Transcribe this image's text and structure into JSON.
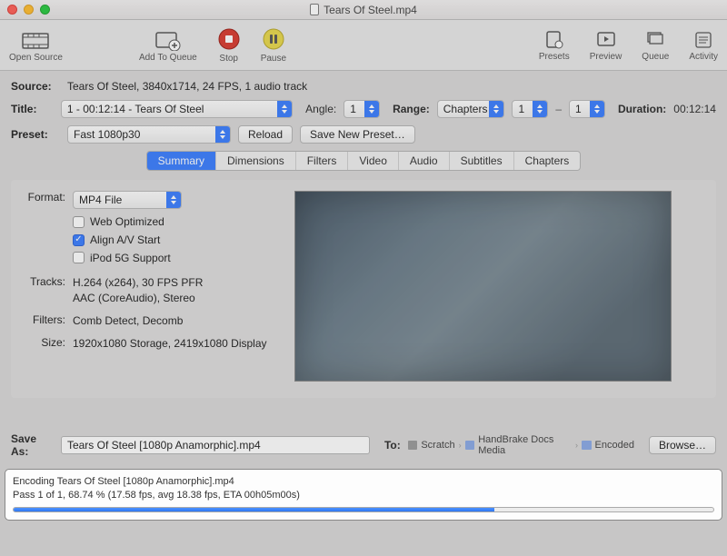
{
  "window": {
    "title": "Tears Of Steel.mp4"
  },
  "toolbar": {
    "open": "Open Source",
    "add": "Add To Queue",
    "stop": "Stop",
    "pause": "Pause",
    "presets": "Presets",
    "preview": "Preview",
    "queue": "Queue",
    "activity": "Activity"
  },
  "source": {
    "label": "Source:",
    "text": "Tears Of Steel, 3840x1714, 24 FPS, 1 audio track"
  },
  "title_row": {
    "label": "Title:",
    "value": "1 - 00:12:14 - Tears Of Steel",
    "angle_label": "Angle:",
    "angle": "1",
    "range_label": "Range:",
    "range_mode": "Chapters",
    "range_from": "1",
    "range_to": "1",
    "duration_label": "Duration:",
    "duration": "00:12:14"
  },
  "preset_row": {
    "label": "Preset:",
    "value": "Fast 1080p30",
    "reload": "Reload",
    "save_new": "Save New Preset…"
  },
  "tabs": [
    "Summary",
    "Dimensions",
    "Filters",
    "Video",
    "Audio",
    "Subtitles",
    "Chapters"
  ],
  "summary": {
    "format_label": "Format:",
    "format_value": "MP4 File",
    "web_opt": "Web Optimized",
    "align_av": "Align A/V Start",
    "ipod": "iPod 5G Support",
    "tracks_label": "Tracks:",
    "tracks_value": "H.264 (x264), 30 FPS PFR\nAAC (CoreAudio), Stereo",
    "filters_label": "Filters:",
    "filters_value": "Comb Detect, Decomb",
    "size_label": "Size:",
    "size_value": "1920x1080 Storage, 2419x1080 Display"
  },
  "save": {
    "label": "Save As:",
    "filename": "Tears Of Steel [1080p Anamorphic].mp4",
    "to_label": "To:",
    "path": [
      "Scratch",
      "HandBrake Docs Media",
      "Encoded"
    ],
    "browse": "Browse…"
  },
  "status": {
    "line1": "Encoding Tears Of Steel [1080p Anamorphic].mp4",
    "line2": "Pass 1 of 1, 68.74 % (17.58 fps, avg 18.38 fps, ETA 00h05m00s)",
    "progress_pct": 68.74
  }
}
